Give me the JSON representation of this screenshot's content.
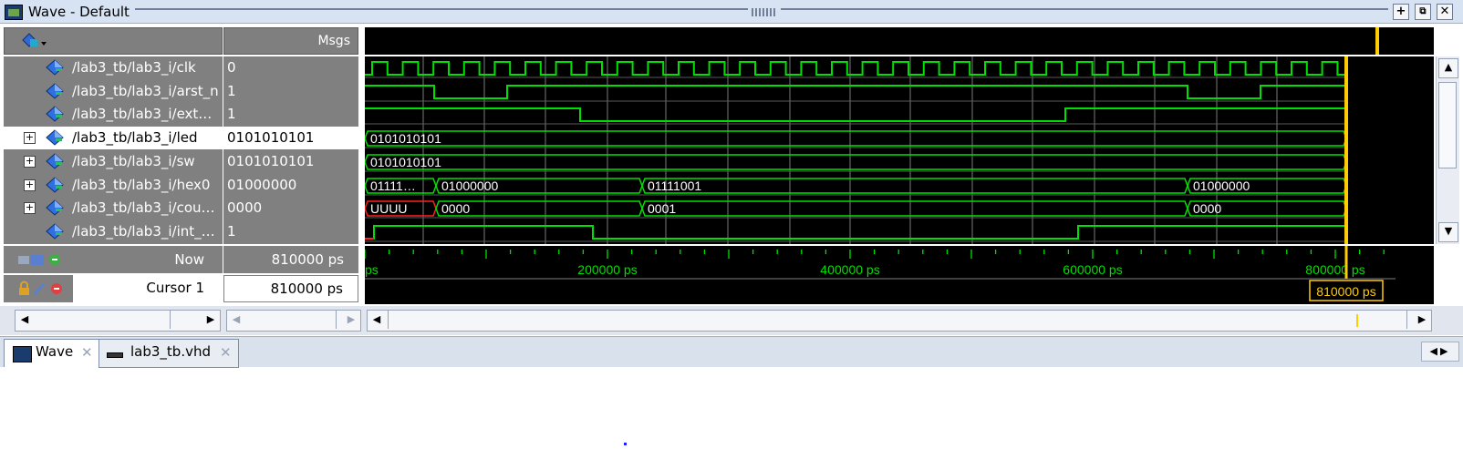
{
  "window": {
    "title": "Wave - Default"
  },
  "header": {
    "msgs_label": "Msgs"
  },
  "signals": [
    {
      "name": "/lab3_tb/lab3_i/clk",
      "value": "0",
      "expandable": false,
      "selected": false
    },
    {
      "name": "/lab3_tb/lab3_i/arst_n",
      "value": "1",
      "expandable": false,
      "selected": false
    },
    {
      "name": "/lab3_tb/lab3_i/ext…",
      "value": "1",
      "expandable": false,
      "selected": false
    },
    {
      "name": "/lab3_tb/lab3_i/led",
      "value": "0101010101",
      "expandable": true,
      "selected": true
    },
    {
      "name": "/lab3_tb/lab3_i/sw",
      "value": "0101010101",
      "expandable": true,
      "selected": false
    },
    {
      "name": "/lab3_tb/lab3_i/hex0",
      "value": "01000000",
      "expandable": true,
      "selected": false
    },
    {
      "name": "/lab3_tb/lab3_i/cou…",
      "value": "0000",
      "expandable": true,
      "selected": false
    },
    {
      "name": "/lab3_tb/lab3_i/int_…",
      "value": "1",
      "expandable": false,
      "selected": false
    }
  ],
  "bus_labels": {
    "led": [
      "0101010101"
    ],
    "sw": [
      "0101010101"
    ],
    "hex0": [
      "01111…",
      "01000000",
      "01111001",
      "01000000"
    ],
    "count": [
      "UUUU",
      "0000",
      "0001",
      "0000"
    ]
  },
  "now": {
    "label": "Now",
    "value": "810000 ps"
  },
  "cursor": {
    "label": "Cursor 1",
    "value": "810000 ps",
    "flag": "810000 ps"
  },
  "timeline": {
    "ticks": [
      "ps",
      "200000 ps",
      "400000 ps",
      "600000 ps",
      "800000 ps"
    ]
  },
  "tabs": [
    {
      "label": "Wave",
      "active": true
    },
    {
      "label": "lab3_tb.vhd",
      "active": false
    }
  ],
  "colors": {
    "wave": "#00e000",
    "cursor": "#ffcc00",
    "grid": "#7a7a7a",
    "undefined": "#ff2020"
  }
}
